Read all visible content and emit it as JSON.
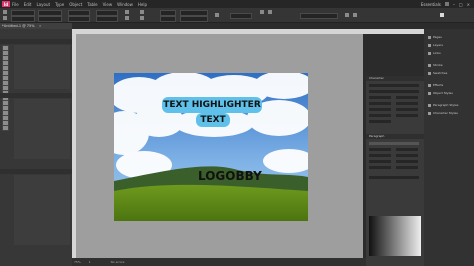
{
  "app": {
    "logo": "Id"
  },
  "menu": [
    "File",
    "Edit",
    "Layout",
    "Type",
    "Object",
    "Table",
    "View",
    "Window",
    "Help"
  ],
  "menu_right": {
    "workspace": "Essentials",
    "search_placeholder": ""
  },
  "document_tab": {
    "title": "*Untitled-1 @ 75%",
    "close": "×"
  },
  "canvas": {
    "highlight_line1": "TEXT HIGHLIGHTER",
    "highlight_line2": "TEXT",
    "logo_text": "LOGOBBY",
    "highlight_color": "#5fc1ea"
  },
  "right_panels": {
    "character": "Character",
    "paragraph": "Paragraph"
  },
  "dock": [
    "Pages",
    "Layers",
    "Links",
    "Stroke",
    "Swatches",
    "Effects",
    "Object Styles",
    "Paragraph Styles",
    "Character Styles"
  ],
  "status": {
    "zoom": "75%",
    "page": "1",
    "errors": "No errors"
  }
}
